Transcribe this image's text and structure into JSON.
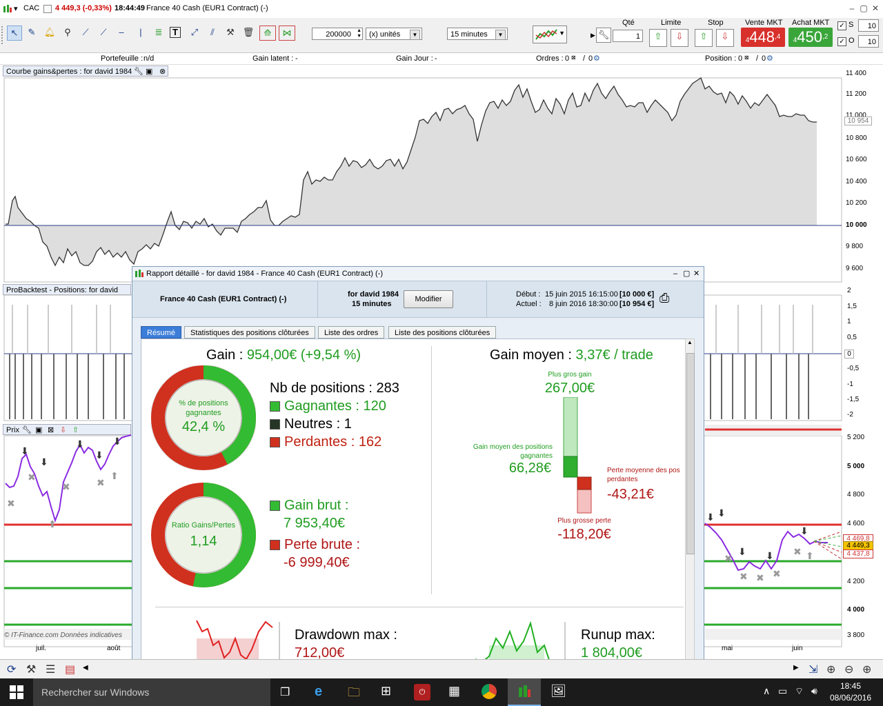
{
  "window": {
    "symbol": "CAC",
    "price_change": "4 449,3 (-0,33%)",
    "time": "18:44:49",
    "instrument": "France 40 Cash (EUR1 Contract) (-)"
  },
  "toolbar": {
    "quantity_value": "200000",
    "units_label": "(x) unités",
    "timeframe": "15 minutes",
    "qte_label": "Qté",
    "qte_value": "1",
    "limite_label": "Limite",
    "stop_label": "Stop",
    "vente_label": "Vente MKT",
    "vente_int": "448",
    "vente_dec": "4",
    "vente_prefix": "4",
    "achat_label": "Achat MKT",
    "achat_int": "450",
    "achat_dec": "2",
    "achat_prefix": "4",
    "s_label": "S",
    "s_value": "10",
    "o_label": "O",
    "o_value": "10"
  },
  "infobar": {
    "portefeuille": "Portefeuille :",
    "portefeuille_val": "n/d",
    "gain_latent": "Gain latent :",
    "gain_latent_val": "-",
    "gain_jour": "Gain Jour :",
    "gain_jour_val": "-",
    "ordres": "Ordres :",
    "ordres_a": "0",
    "ordres_sep": "/",
    "ordres_b": "0",
    "position": "Position :",
    "position_a": "0",
    "position_sep": "/",
    "position_b": "0"
  },
  "panels": {
    "equity_title": "Courbe gains&pertes : for david 1984",
    "positions_title": "ProBacktest - Positions: for david 1984",
    "price_title": "Prix"
  },
  "axes": {
    "equity_ticks": [
      "11 400",
      "11 200",
      "11 000",
      "10 800",
      "10 600",
      "10 400",
      "10 200",
      "10 000",
      "9 800",
      "9 600"
    ],
    "equity_current": "10 954",
    "positions_ticks": [
      "2",
      "1,5",
      "1",
      "0,5",
      "0",
      "-0,5",
      "-1",
      "-1,5",
      "-2"
    ],
    "price_ticks": [
      "5 200",
      "5 000",
      "4 800",
      "4 600",
      "4 400",
      "4 200",
      "4 000",
      "3 800"
    ],
    "price_current": "4 449,3",
    "price_tag_a": "4 469,8",
    "price_tag_b": "4 437,8",
    "x_ticks": [
      "juil.",
      "août",
      "mai",
      "juin"
    ],
    "watermark": "© IT-Finance.com Données indicatives"
  },
  "report": {
    "title": "Rapport détaillé - for david 1984 - France 40 Cash (EUR1 Contract) (-)",
    "instrument": "France 40 Cash (EUR1 Contract) (-)",
    "for_user": "for david 1984",
    "timeframe": "15 minutes",
    "modify_button": "Modifier",
    "debut_label": "Début :",
    "debut_value": "15 juin 2015 16:15:00",
    "debut_cap": "[10 000 €]",
    "actuel_label": "Actuel :",
    "actuel_value": "8 juin 2016 18:30:00",
    "actuel_cap": "[10 954 €]",
    "tabs": [
      "Résumé",
      "Statistiques des positions clôturées",
      "Liste des ordres",
      "Liste des positions clôturées"
    ],
    "gain_label": "Gain :",
    "gain_value": "954,00€ (+9,54 %)",
    "pct_label_1": "% de positions",
    "pct_label_2": "gagnantes",
    "pct_value": "42,4 %",
    "nb_positions": "Nb de positions : 283",
    "gagnantes": "Gagnantes : 120",
    "neutres": "Neutres : 1",
    "perdantes": "Perdantes : 162",
    "ratio_label": "Ratio Gains/Pertes",
    "ratio_value": "1,14",
    "gain_brut_label": "Gain brut :",
    "gain_brut_value": "7 953,40€",
    "perte_brute_label": "Perte brute :",
    "perte_brute_value": "-6 999,40€",
    "gain_moyen_label": "Gain moyen :",
    "gain_moyen_value": "3,37€ / trade",
    "plus_gros_gain_label": "Plus gros gain",
    "plus_gros_gain_value": "267,00€",
    "gain_moyen_pos_label_1": "Gain moyen des positions",
    "gain_moyen_pos_label_2": "gagnantes",
    "gain_moyen_pos_value": "66,28€",
    "perte_moy_label_1": "Perte moyenne des pos",
    "perte_moy_label_2": "perdantes",
    "perte_moy_value": "-43,21€",
    "plus_grosse_perte_label": "Plus grosse perte",
    "plus_grosse_perte_value": "-118,20€",
    "drawdown_label": "Drawdown max :",
    "drawdown_value": "712,00€",
    "runup_label": "Runup max:",
    "runup_value": "1 804,00€"
  },
  "taskbar": {
    "search_placeholder": "Rechercher sur Windows",
    "clock_time": "18:45",
    "clock_date": "08/06/2016"
  },
  "colors": {
    "win_green": "#33bb33",
    "loss_red": "#d0301e",
    "accent_blue": "#3b7dd8",
    "sell": "#d8302b",
    "buy": "#3aa63a"
  }
}
